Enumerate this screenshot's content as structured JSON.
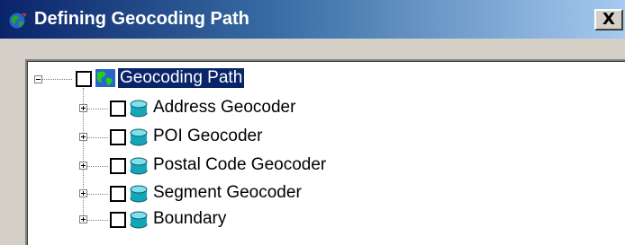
{
  "window": {
    "title": "Defining Geocoding Path",
    "close_label": "X"
  },
  "tree": {
    "root": {
      "label": "Geocoding Path",
      "expanded": true,
      "checked": false,
      "selected": true
    },
    "children": [
      {
        "label": "Address Geocoder",
        "expanded": false,
        "checked": false
      },
      {
        "label": "POI Geocoder",
        "expanded": false,
        "checked": false
      },
      {
        "label": "Postal Code Geocoder",
        "expanded": false,
        "checked": false
      },
      {
        "label": "Segment Geocoder",
        "expanded": false,
        "checked": false
      },
      {
        "label": "Boundary",
        "expanded": false,
        "checked": false
      }
    ]
  },
  "icons": {
    "title": "globe-icon",
    "root": "globe-icon",
    "child": "database-icon"
  },
  "colors": {
    "titlebar_start": "#0a246a",
    "titlebar_end": "#a6caf0",
    "selection": "#0a246a",
    "dialog_bg": "#d4d0c8"
  }
}
